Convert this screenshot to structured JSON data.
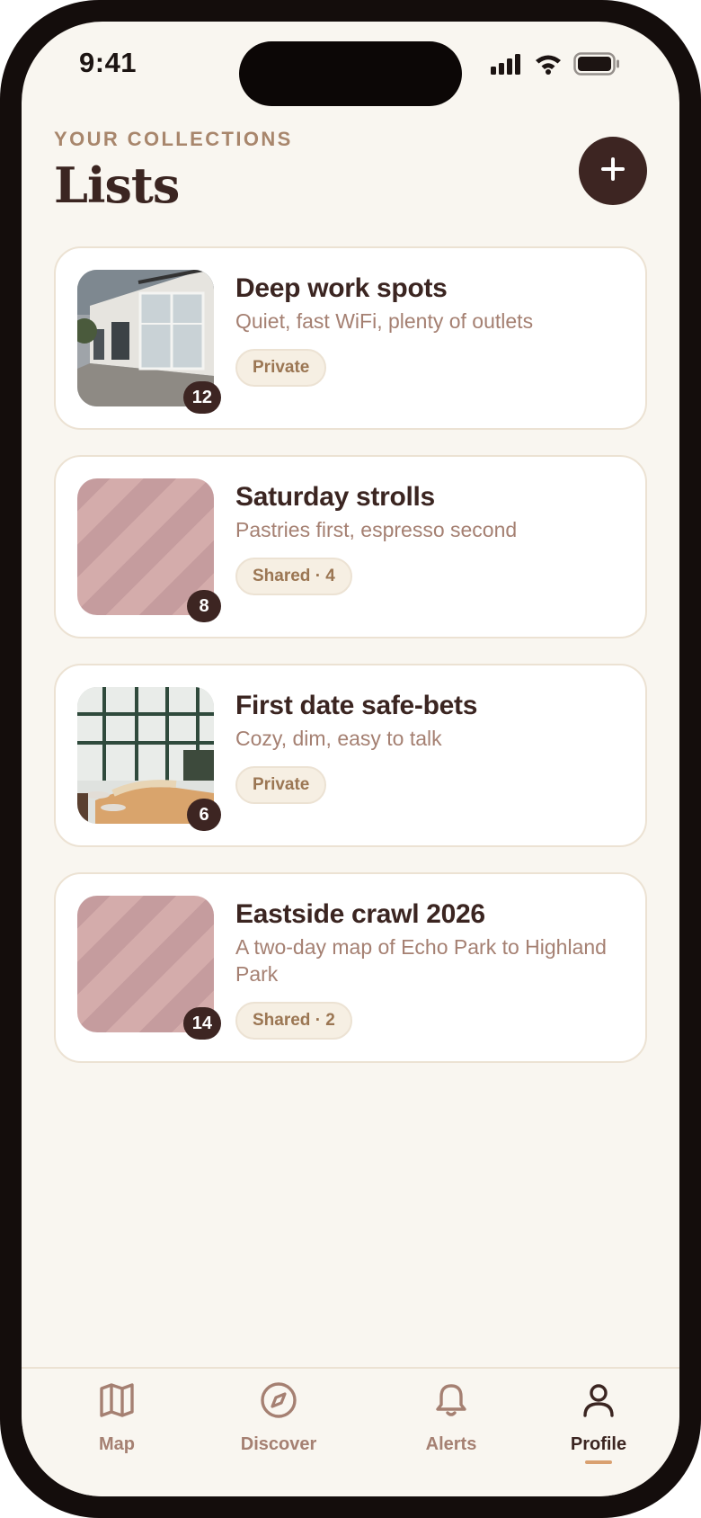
{
  "status_bar": {
    "time": "9:41"
  },
  "header": {
    "eyebrow": "YOUR COLLECTIONS",
    "title": "Lists"
  },
  "lists": [
    {
      "title": "Deep work spots",
      "description": "Quiet, fast WiFi, plenty of outlets",
      "visibility": "Private",
      "count": "12",
      "thumbnail": "photo-storefront"
    },
    {
      "title": "Saturday strolls",
      "description": "Pastries first, espresso second",
      "visibility": "Shared · 4",
      "count": "8",
      "thumbnail": "striped-placeholder"
    },
    {
      "title": "First date safe-bets",
      "description": "Cozy, dim, easy to talk",
      "visibility": "Private",
      "count": "6",
      "thumbnail": "photo-cafe-interior"
    },
    {
      "title": "Eastside crawl 2026",
      "description": "A two-day map of Echo Park to Highland Park",
      "visibility": "Shared · 2",
      "count": "14",
      "thumbnail": "striped-placeholder"
    }
  ],
  "tabbar": {
    "items": [
      {
        "label": "Map",
        "icon": "map-icon"
      },
      {
        "label": "Discover",
        "icon": "compass-icon"
      },
      {
        "label": "Alerts",
        "icon": "bell-icon"
      },
      {
        "label": "Profile",
        "icon": "person-icon",
        "active": true
      }
    ]
  },
  "colors": {
    "background": "#f9f6f0",
    "accent_dark": "#3d2522",
    "muted_text": "#a58072",
    "tab_indicator": "#d9a070"
  }
}
